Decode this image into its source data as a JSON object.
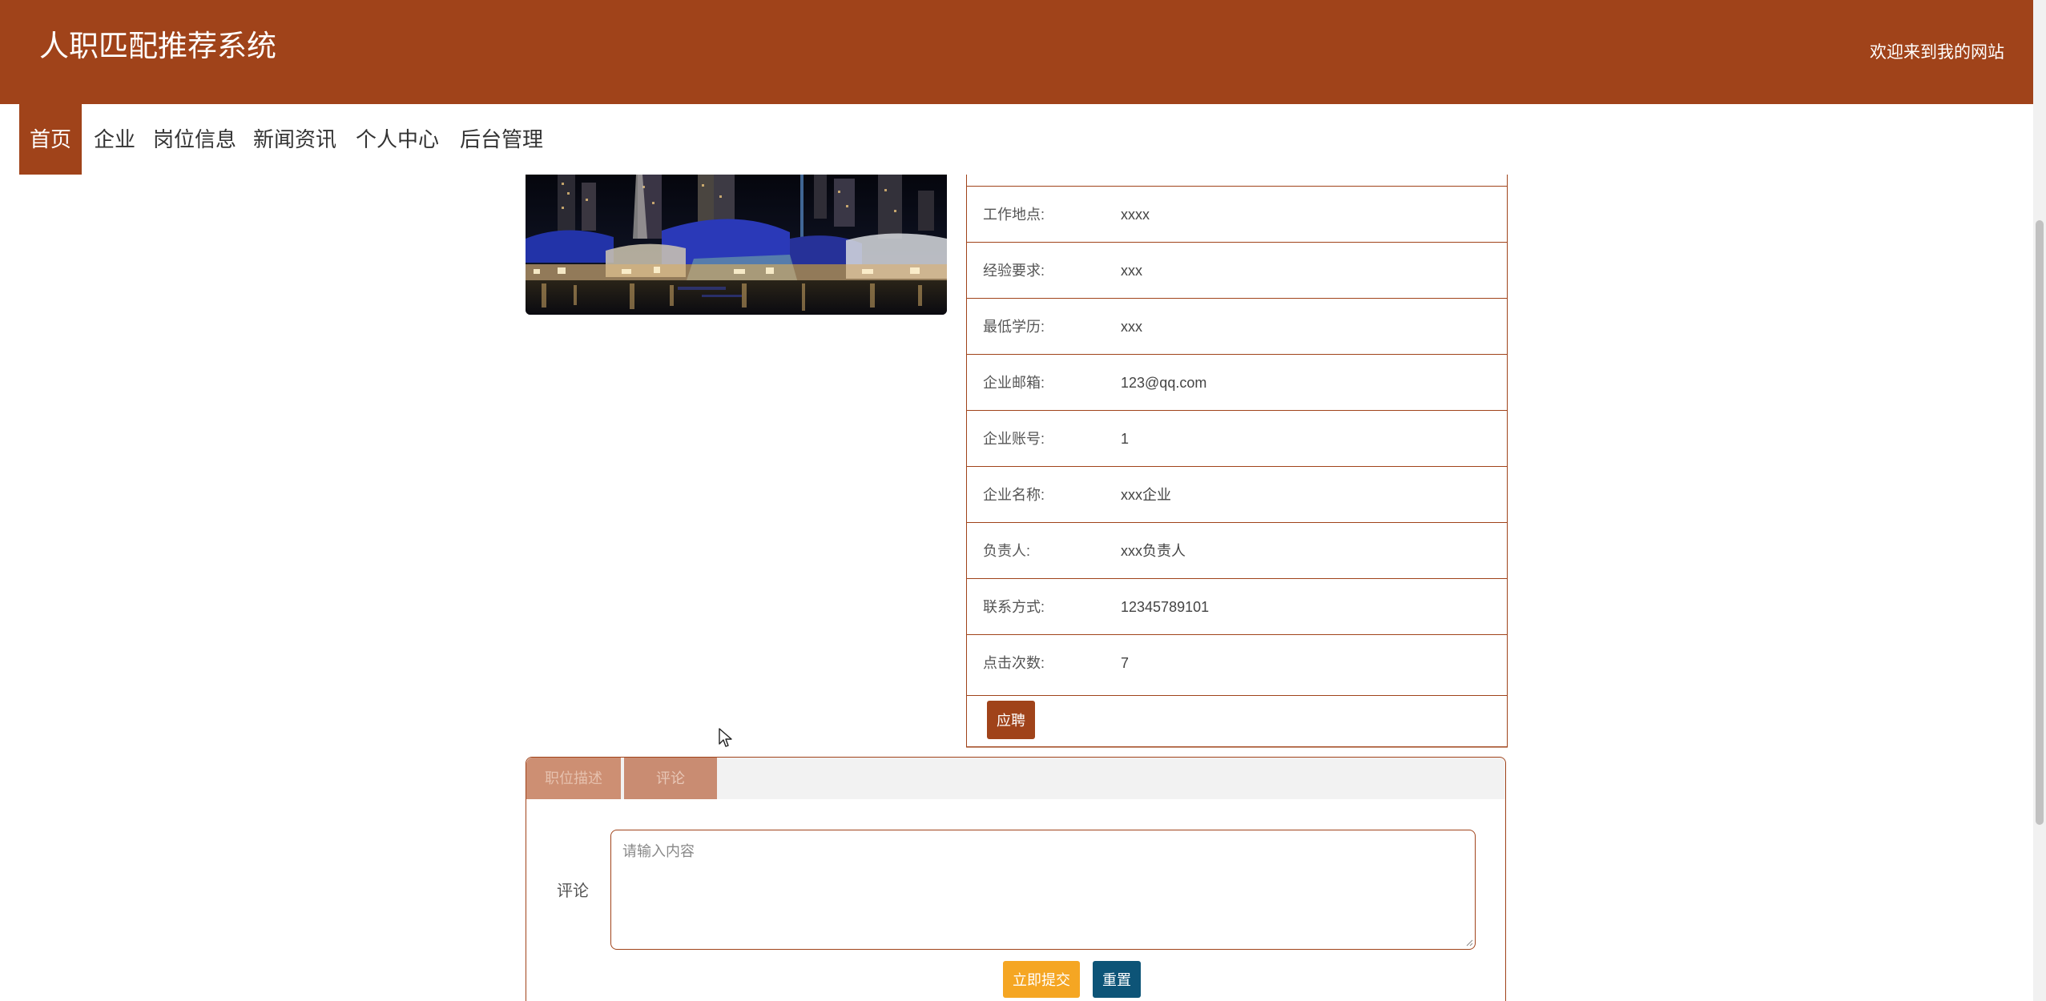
{
  "header": {
    "title": "人职匹配推荐系统",
    "welcome": "欢迎来到我的网站"
  },
  "nav": {
    "items": [
      {
        "label": "首页",
        "active": true
      },
      {
        "label": "企业",
        "active": false
      },
      {
        "label": "岗位信息",
        "active": false
      },
      {
        "label": "新闻资讯",
        "active": false
      },
      {
        "label": "个人中心",
        "active": false
      },
      {
        "label": "后台管理",
        "active": false
      }
    ]
  },
  "details": {
    "rows": [
      {
        "label": "工作地点:",
        "value": "xxxx"
      },
      {
        "label": "经验要求:",
        "value": "xxx"
      },
      {
        "label": "最低学历:",
        "value": "xxx"
      },
      {
        "label": "企业邮箱:",
        "value": "123@qq.com"
      },
      {
        "label": "企业账号:",
        "value": "1"
      },
      {
        "label": "企业名称:",
        "value": "xxx企业"
      },
      {
        "label": "负责人:",
        "value": "xxx负责人"
      },
      {
        "label": "联系方式:",
        "value": "12345789101"
      },
      {
        "label": "点击次数:",
        "value": "7"
      }
    ],
    "apply_label": "应聘"
  },
  "tabs": {
    "items": [
      {
        "label": "职位描述"
      },
      {
        "label": "评论"
      }
    ]
  },
  "comment": {
    "label": "评论",
    "placeholder": "请输入内容",
    "submit_label": "立即提交",
    "reset_label": "重置"
  },
  "colors": {
    "brand": "#a0431a",
    "submit": "#f5a623",
    "reset": "#0d5477"
  }
}
